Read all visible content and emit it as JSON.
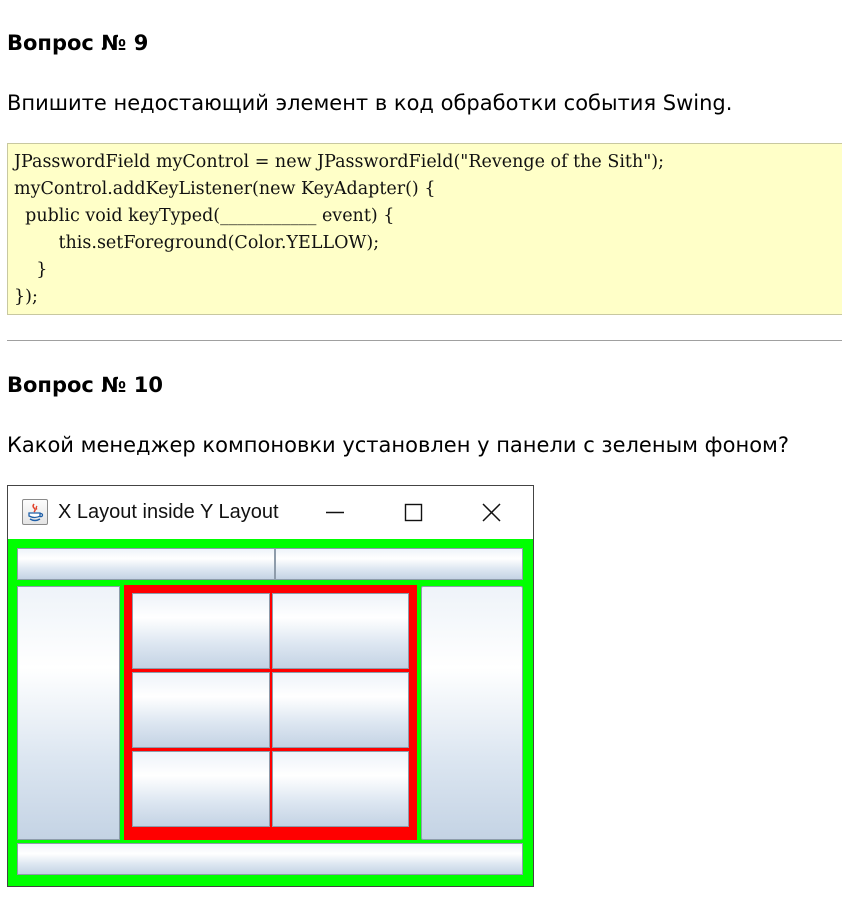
{
  "question9": {
    "title": "Вопрос № 9",
    "text": "Впишите недостающий элемент в код обработки события Swing.",
    "code_lines": [
      "JPasswordField myControl = new JPasswordField(\"Revenge of the Sith\");",
      "myControl.addKeyListener(new KeyAdapter() {",
      "  public void keyTyped(___________ event) {",
      "        this.setForeground(Color.YELLOW);",
      "    }",
      "});"
    ]
  },
  "question10": {
    "title": "Вопрос № 10",
    "text": "Какой менеджер компоновки установлен у панели с зеленым фоном?"
  },
  "window": {
    "title": "X Layout inside Y Layout",
    "icon": "java-coffee-cup-icon",
    "controls": [
      "minimize-icon",
      "maximize-icon",
      "close-icon"
    ],
    "colors": {
      "outer_panel": "#00ff00",
      "inner_panel": "#ff0000"
    }
  }
}
